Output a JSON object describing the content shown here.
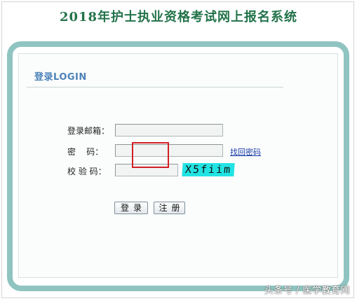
{
  "site_title": "2018年护士执业资格考试网上报名系统",
  "login": {
    "heading": "登录LOGIN",
    "email_label": "登录邮箱：",
    "email_value": "",
    "password_label": "密    码：",
    "password_value": "",
    "forgot_link": "找回密码",
    "captcha_label": "校 验 码：",
    "captcha_value": "",
    "captcha_text": "X5fiim",
    "login_button": "登录",
    "register_button": "注册"
  },
  "watermark": "头条号 / 医学教育网",
  "colors": {
    "title": "#23734a",
    "panel_border": "#8fc4c1",
    "heading": "#4b82b8",
    "captcha_bg": "#22e3e3",
    "highlight": "#d21f26"
  }
}
